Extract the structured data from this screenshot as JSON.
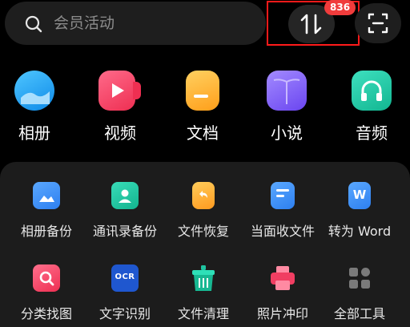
{
  "search": {
    "placeholder": "会员活动"
  },
  "transfer": {
    "badge": "836"
  },
  "categories": [
    {
      "label": "相册",
      "icon": "album-icon",
      "color": "#1aa3f2"
    },
    {
      "label": "视频",
      "icon": "video-icon",
      "color": "#f24c6a"
    },
    {
      "label": "文档",
      "icon": "document-icon",
      "color": "#ffb02e"
    },
    {
      "label": "小说",
      "icon": "novel-icon",
      "color": "#7a5cf5"
    },
    {
      "label": "音频",
      "icon": "audio-icon",
      "color": "#1ec9a7"
    }
  ],
  "tools": [
    {
      "label": "相册备份",
      "icon": "album-backup-icon",
      "color": "#3d8ff5"
    },
    {
      "label": "通讯录备份",
      "icon": "contacts-backup-icon",
      "color": "#1fc4a0"
    },
    {
      "label": "文件恢复",
      "icon": "file-restore-icon",
      "color": "#ffa42e"
    },
    {
      "label": "当面收文件",
      "icon": "receive-file-icon",
      "color": "#3d8ff5"
    },
    {
      "label": "转为 Word",
      "icon": "convert-word-icon",
      "color": "#3d8ff5",
      "glyph": "W"
    },
    {
      "label": "分类找图",
      "icon": "find-image-icon",
      "color": "#f24c6a"
    },
    {
      "label": "文字识别",
      "icon": "ocr-icon",
      "color": "#2f6ff0",
      "glyph": "OCR"
    },
    {
      "label": "文件清理",
      "icon": "file-cleanup-icon",
      "color": "#1fc4a0"
    },
    {
      "label": "照片冲印",
      "icon": "photo-print-icon",
      "color": "#f24c6a"
    },
    {
      "label": "全部工具",
      "icon": "all-tools-icon",
      "color": "#6e6e6e"
    }
  ]
}
